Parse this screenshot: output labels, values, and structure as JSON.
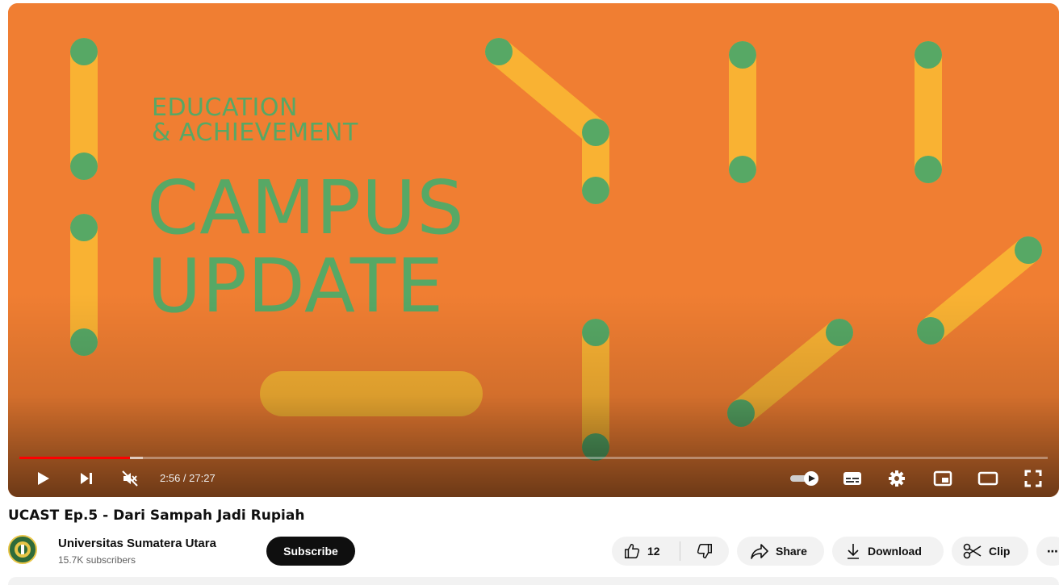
{
  "video": {
    "art": {
      "line1": "EDUCATION",
      "line2": "& ACHIEVEMENT",
      "line3": "CAMPUS",
      "line4": "UPDATE",
      "bg_color": "#f07e32",
      "stick_color": "#f9b233",
      "dot_color": "#57a865"
    },
    "progress": {
      "played_fraction": 0.1076,
      "buffered_fraction": 0.12
    },
    "time_display": "2:56 / 27:27",
    "controls": {
      "play_icon": "play-icon",
      "next_icon": "next-icon",
      "mute_icon": "muted-speaker-icon",
      "autoplay_icon": "autoplay-toggle-icon",
      "subtitles_icon": "subtitles-icon",
      "settings_icon": "gear-icon",
      "miniplayer_icon": "miniplayer-icon",
      "theater_icon": "theater-mode-icon",
      "fullscreen_icon": "fullscreen-icon"
    }
  },
  "title": "UCAST Ep.5 - Dari Sampah Jadi Rupiah",
  "channel": {
    "name": "Universitas Sumatera Utara",
    "subscribers": "15.7K subscribers",
    "subscribe_label": "Subscribe"
  },
  "actions": {
    "like_count": "12",
    "share_label": "Share",
    "download_label": "Download",
    "clip_label": "Clip",
    "more_label": "⋯"
  }
}
